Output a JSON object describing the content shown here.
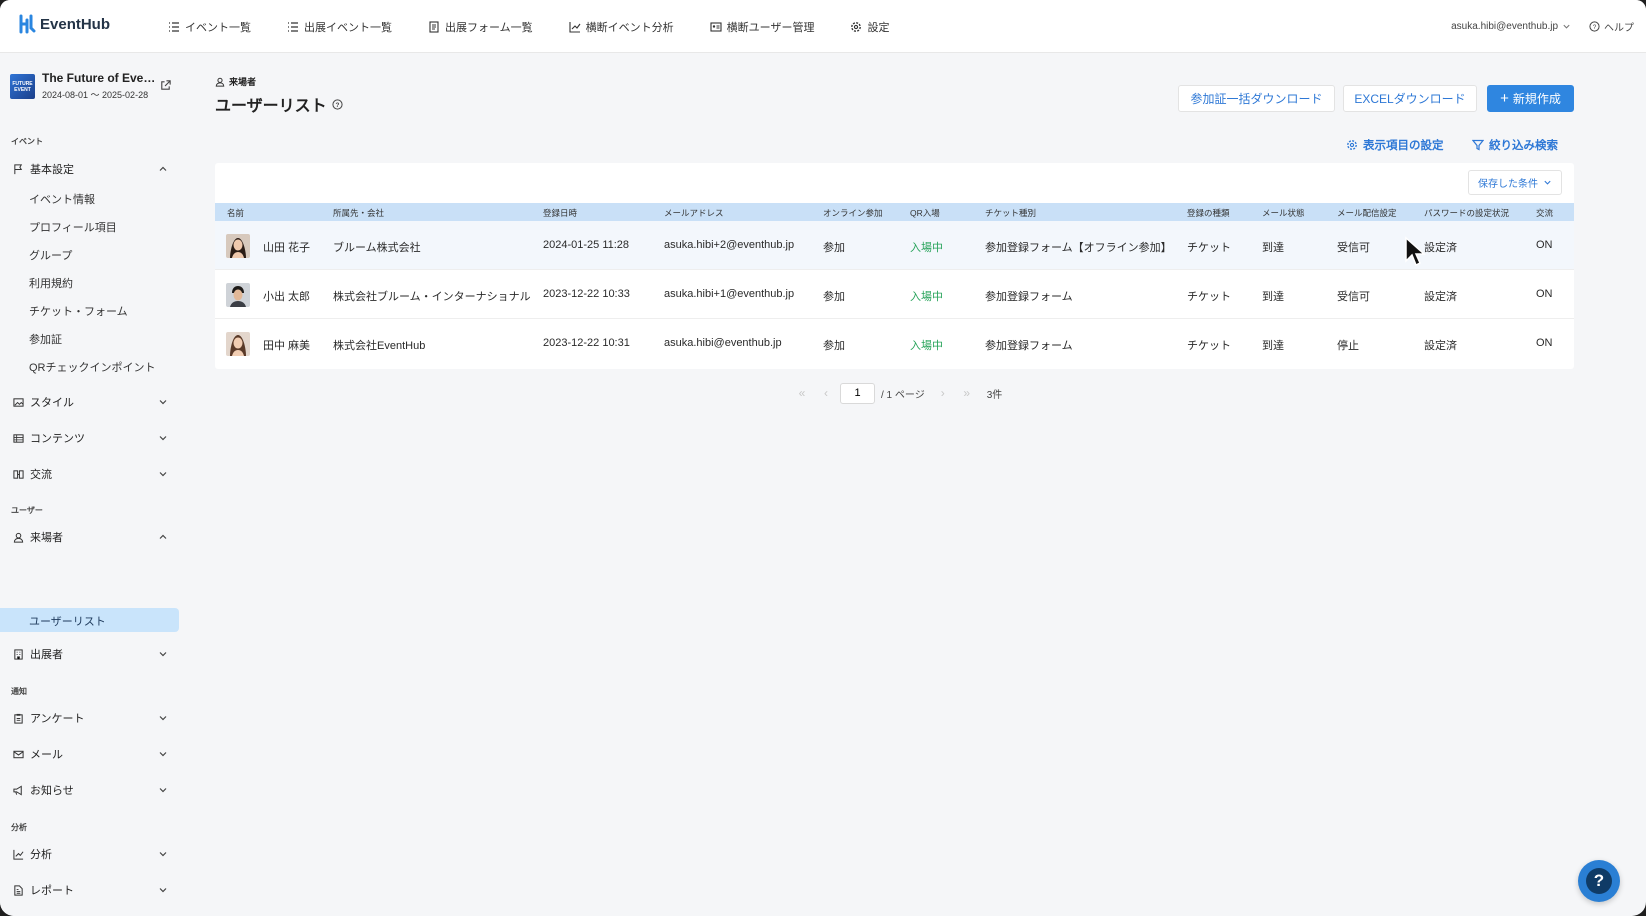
{
  "brand": {
    "name": "EventHub"
  },
  "nav": {
    "items": [
      {
        "label": "イベント一覧",
        "icon": "list-icon"
      },
      {
        "label": "出展イベント一覧",
        "icon": "list-icon"
      },
      {
        "label": "出展フォーム一覧",
        "icon": "form-icon"
      },
      {
        "label": "横断イベント分析",
        "icon": "chart-icon"
      },
      {
        "label": "横断ユーザー管理",
        "icon": "id-card-icon"
      },
      {
        "label": "設定",
        "icon": "gear-icon"
      }
    ],
    "user_email": "asuka.hibi@eventhub.jp",
    "help": "ヘルプ"
  },
  "event": {
    "title": "The Future of Eve…",
    "period": "2024-08-01 ～ 2025-02-28",
    "thumb_text": "FUTURE EVENT"
  },
  "sidebar": {
    "sections": {
      "event": "イベント",
      "user": "ユーザー",
      "notify": "通知",
      "analysis": "分析"
    },
    "basic": "基本設定",
    "basic_children": [
      "イベント情報",
      "プロフィール項目",
      "グループ",
      "利用規約",
      "チケット・フォーム",
      "参加証",
      "QRチェックインポイント"
    ],
    "style": "スタイル",
    "contents": "コンテンツ",
    "exchange": "交流",
    "visitors": "来場者",
    "user_list": "ユーザーリスト",
    "exhibitors": "出展者",
    "survey": "アンケート",
    "mail": "メール",
    "notice": "お知らせ",
    "analytics": "分析",
    "report": "レポート"
  },
  "page": {
    "breadcrumb": "来場者",
    "title": "ユーザーリスト",
    "buttons": {
      "bulk_download": "参加証一括ダウンロード",
      "excel_download": "EXCELダウンロード",
      "create_new": "新規作成"
    },
    "display_settings": "表示項目の設定",
    "filter_search": "絞り込み検索",
    "saved_conditions": "保存した条件"
  },
  "table": {
    "columns": [
      "名前",
      "所属先・会社",
      "登録日時",
      "メールアドレス",
      "オンライン参加",
      "QR入場",
      "チケット種別",
      "登録の種類",
      "メール状態",
      "メール配信設定",
      "パスワードの設定状況",
      "交流"
    ],
    "rows": [
      {
        "name": "山田 花子",
        "company": "ブルーム株式会社",
        "registered": "2024-01-25 11:28",
        "email": "asuka.hibi+2@eventhub.jp",
        "online": "参加",
        "qr": "入場中",
        "ticket": "参加登録フォーム【オフライン参加】",
        "reg_type": "チケット",
        "mail_status": "到達",
        "mail_setting": "受信可",
        "password": "設定済",
        "exchange": "ON"
      },
      {
        "name": "小出 太郎",
        "company": "株式会社ブルーム・インターナショナル",
        "registered": "2023-12-22 10:33",
        "email": "asuka.hibi+1@eventhub.jp",
        "online": "参加",
        "qr": "入場中",
        "ticket": "参加登録フォーム",
        "reg_type": "チケット",
        "mail_status": "到達",
        "mail_setting": "受信可",
        "password": "設定済",
        "exchange": "ON"
      },
      {
        "name": "田中 麻美",
        "company": "株式会社EventHub",
        "registered": "2023-12-22 10:31",
        "email": "asuka.hibi@eventhub.jp",
        "online": "参加",
        "qr": "入場中",
        "ticket": "参加登録フォーム",
        "reg_type": "チケット",
        "mail_status": "到達",
        "mail_setting": "停止",
        "password": "設定済",
        "exchange": "ON"
      }
    ]
  },
  "pagination": {
    "current": "1",
    "total_label": "/ 1 ページ",
    "count": "3件"
  },
  "colors": {
    "accent": "#2f86e0",
    "status_green": "#27a35a",
    "header_bg": "#c9e0f7",
    "active_bg": "#c9e4fb"
  }
}
